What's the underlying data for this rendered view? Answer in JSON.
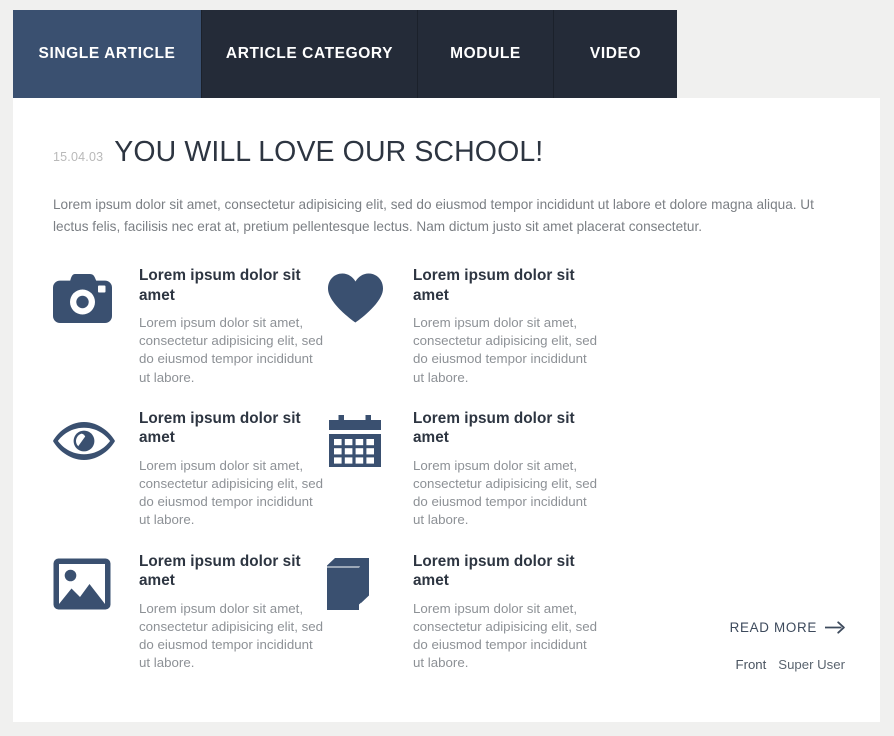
{
  "colors": {
    "accent": "#3a5070",
    "tab_inactive": "#242b38",
    "icon": "#3a5070",
    "heading": "#2d3541",
    "body_text": "#8d9196",
    "page_background": "#f0f0ef",
    "panel_background": "#ffffff"
  },
  "tabs": [
    {
      "label": "SINGLE ARTICLE",
      "active": true,
      "name": "tab-single-article"
    },
    {
      "label": "ARTICLE CATEGORY",
      "active": false,
      "name": "tab-article-category"
    },
    {
      "label": "MODULE",
      "active": false,
      "name": "tab-module"
    },
    {
      "label": "VIDEO",
      "active": false,
      "name": "tab-video"
    }
  ],
  "article": {
    "date": "15.04.03",
    "title": "YOU WILL LOVE OUR SCHOOL!",
    "intro": "Lorem ipsum dolor sit amet, consectetur adipisicing elit, sed do eiusmod tempor incididunt ut labore et dolore magna aliqua. Ut lectus felis, facilisis nec erat at, pretium pellentesque lectus. Nam dictum justo sit amet placerat consectetur."
  },
  "features": [
    {
      "icon": "camera-icon",
      "title": "Lorem ipsum dolor sit amet",
      "text": "Lorem ipsum dolor sit amet, consectetur adipisicing elit, sed do eiusmod tempor incididunt ut labore."
    },
    {
      "icon": "heart-icon",
      "title": "Lorem ipsum dolor sit amet",
      "text": "Lorem ipsum dolor sit amet, consectetur adipisicing elit, sed do eiusmod tempor incididunt ut labore."
    },
    {
      "icon": "eye-icon",
      "title": "Lorem ipsum dolor sit amet",
      "text": "Lorem ipsum dolor sit amet, consectetur adipisicing elit, sed do eiusmod tempor incididunt ut labore."
    },
    {
      "icon": "calendar-icon",
      "title": "Lorem ipsum dolor sit amet",
      "text": "Lorem ipsum dolor sit amet, consectetur adipisicing elit, sed do eiusmod tempor incididunt ut labore."
    },
    {
      "icon": "image-icon",
      "title": "Lorem ipsum dolor sit amet",
      "text": "Lorem ipsum dolor sit amet, consectetur adipisicing elit, sed do eiusmod tempor incididunt ut labore."
    },
    {
      "icon": "book-icon",
      "title": "Lorem ipsum dolor sit amet",
      "text": "Lorem ipsum dolor sit amet, consectetur adipisicing elit, sed do eiusmod tempor incididunt ut labore."
    }
  ],
  "footer": {
    "read_more": "READ MORE",
    "read_more_icon": "arrow-right-icon",
    "category": "Front",
    "author": "Super User"
  }
}
